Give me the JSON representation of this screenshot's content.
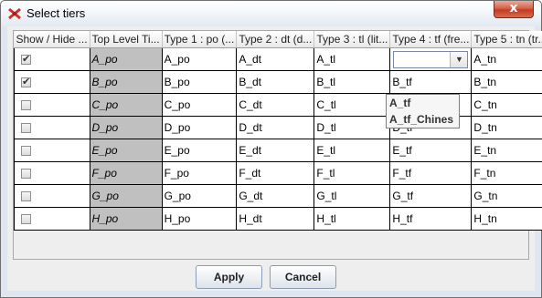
{
  "window": {
    "title": "Select tiers",
    "close_label": "x",
    "app_icon": "app-logo-icon"
  },
  "table": {
    "columns": [
      "Show / Hide ...",
      "Top Level Ti...",
      "Type 1 : po (...",
      "Type 2 : dt (d...",
      "Type 3 : tl (lit...",
      "Type 4 : tf (fre...",
      "Type 5 : tn (tr..."
    ],
    "rows": [
      {
        "checked": true,
        "cells": [
          "A_po",
          "A_po",
          "A_dt",
          "A_tl",
          "",
          "A_tn"
        ]
      },
      {
        "checked": true,
        "cells": [
          "B_po",
          "B_po",
          "B_dt",
          "B_tl",
          "B_tf",
          "B_tn"
        ]
      },
      {
        "checked": false,
        "cells": [
          "C_po",
          "C_po",
          "C_dt",
          "C_tl",
          "C_tf",
          "C_tn"
        ]
      },
      {
        "checked": false,
        "cells": [
          "D_po",
          "D_po",
          "D_dt",
          "D_tl",
          "D_tf",
          "D_tn"
        ]
      },
      {
        "checked": false,
        "cells": [
          "E_po",
          "E_po",
          "E_dt",
          "E_tl",
          "E_tf",
          "E_tn"
        ]
      },
      {
        "checked": false,
        "cells": [
          "F_po",
          "F_po",
          "F_dt",
          "F_tl",
          "F_tf",
          "F_tn"
        ]
      },
      {
        "checked": false,
        "cells": [
          "G_po",
          "G_po",
          "G_dt",
          "G_tl",
          "G_tf",
          "G_tn"
        ]
      },
      {
        "checked": false,
        "cells": [
          "H_po",
          "H_po",
          "H_dt",
          "H_tl",
          "H_tf",
          "H_tn"
        ]
      }
    ],
    "active_editor": {
      "row": 0,
      "column": "Type 4 : tf (fre...",
      "value": ""
    },
    "dropdown_options": [
      "A_tf",
      "A_tf_Chines"
    ]
  },
  "buttons": {
    "apply": "Apply",
    "cancel": "Cancel"
  }
}
